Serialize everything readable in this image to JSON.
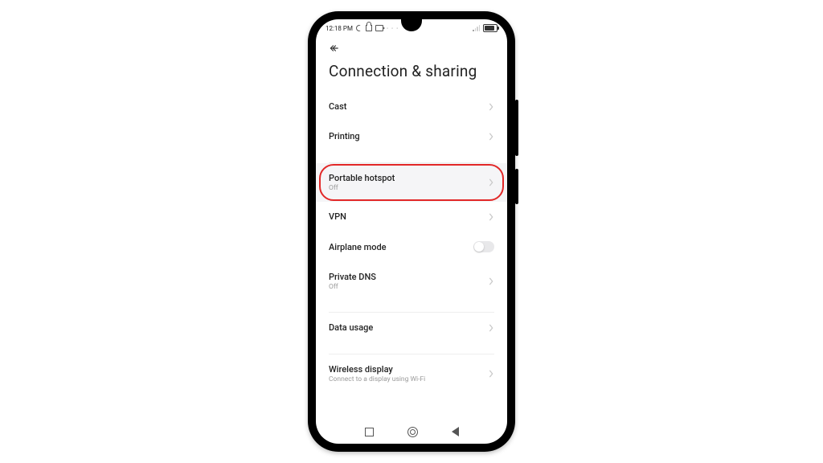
{
  "status": {
    "time": "12:18 PM",
    "dots": "· · ·"
  },
  "page_title": "Connection & sharing",
  "items": {
    "cast": {
      "label": "Cast"
    },
    "printing": {
      "label": "Printing"
    },
    "hotspot": {
      "label": "Portable hotspot",
      "sub": "Off"
    },
    "vpn": {
      "label": "VPN"
    },
    "airplane": {
      "label": "Airplane mode"
    },
    "private_dns": {
      "label": "Private DNS",
      "sub": "Off"
    },
    "data_usage": {
      "label": "Data usage"
    },
    "wireless": {
      "label": "Wireless display",
      "sub": "Connect to a display using Wi-Fi"
    }
  }
}
